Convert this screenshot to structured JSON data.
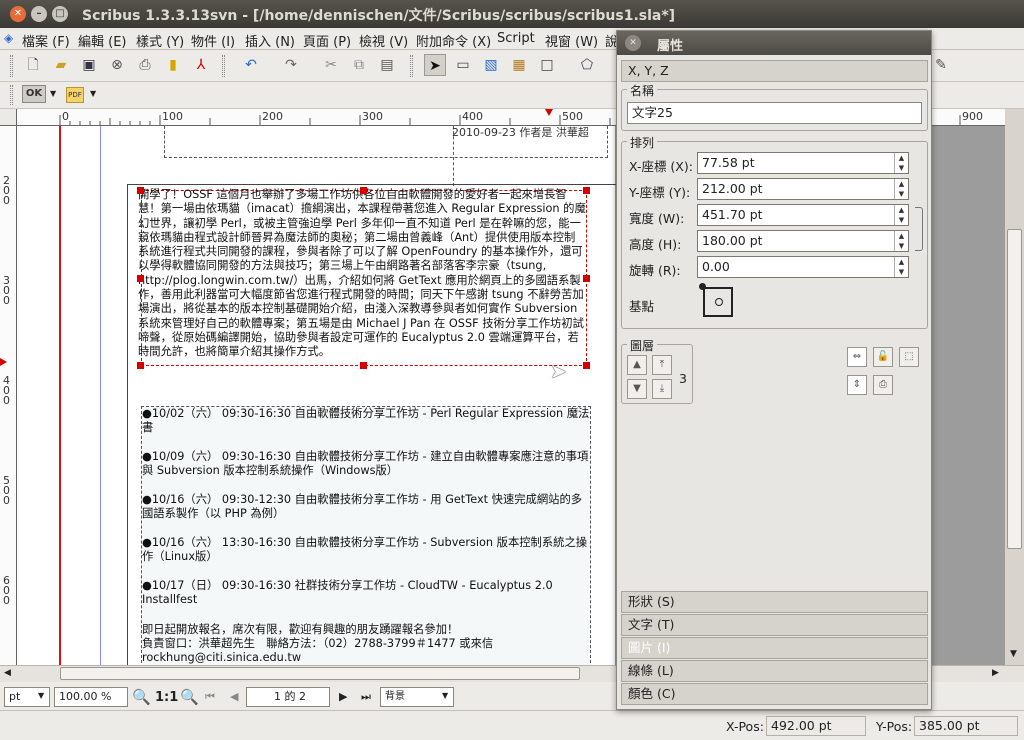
{
  "window": {
    "title": "Scribus 1.3.3.13svn - [/home/dennischen/文件/Scribus/scribus/scribus1.sla*]"
  },
  "menu": [
    "檔案 (F)",
    "編輯 (E)",
    "樣式 (Y)",
    "物件 (I)",
    "插入 (N)",
    "頁面 (P)",
    "檢視 (V)",
    "附加命令 (X)",
    "Script",
    "視窗 (W)",
    "說明 (H)"
  ],
  "toolbar2": {
    "ok_label": "OK",
    "pdf_label": "PDF"
  },
  "ruler": {
    "h": [
      "0",
      "100",
      "200",
      "300",
      "400",
      "500",
      "900"
    ],
    "v": [
      "200",
      "300",
      "400",
      "500",
      "600"
    ]
  },
  "document": {
    "header_fragment": "2010-09-23   作者是 洪華超",
    "paragraph": "開學了！OSSF 這個月也舉辦了多場工作坊供各位自由軟體開發的愛好者一起來增長智慧！第一場由依瑪貓（imacat）擔綱演出，本課程帶著您進入 Regular Expression 的魔幻世界，讓初學 Perl，或被主管強迫學 Perl 多年仰一直不知道 Perl 是在幹嘛的您，能一窺依瑪貓由程式設計師晉昇為魔法師的奧秘；第二場由曾義峰（Ant）提供使用版本控制系統進行程式共同開發的課程，參與者除了可以了解 OpenFoundry 的基本操作外，還可以學得軟體協同開發的方法與技巧；第三場上午由網路著名部落客李宗豪（tsung, http://plog.longwin.com.tw/）出馬，介紹如何將 GetText 應用於網頁上的多國語系製作，善用此利器當可大幅度節省您進行程式開發的時間；同天下午感謝 tsung 不辭勞苦加場演出，將從基本的版本控制基礎開始介紹，由淺入深教導參與者如何實作 Subversion 系統來管理好自己的軟體專案；第五場是由 Michael J Pan 在 OSSF 技術分享工作坊初試啼聲，從原始碼編譯開始，協助參與者設定可運作的 Eucalyptus 2.0 雲端運算平台，若時間允許，也將簡單介紹其操作方式。",
    "events": [
      "●10/02（六） 09:30-16:30 自由軟體技術分享工作坊 - Perl Regular Expression 魔法書",
      "●10/09（六） 09:30-16:30 自由軟體技術分享工作坊 - 建立自由軟體專案應注意的事項與 Subversion 版本控制系統操作（Windows版）",
      "●10/16（六） 09:30-12:30 自由軟體技術分享工作坊 - 用 GetText 快速完成網站的多國語系製作（以 PHP 為例）",
      "●10/16（六） 13:30-16:30 自由軟體技術分享工作坊 - Subversion 版本控制系統之操作（Linux版）",
      "●10/17（日） 09:30-16:30 社群技術分享工作坊 - CloudTW - Eucalyptus 2.0 Installfest"
    ],
    "footer1": "即日起開放報名，席次有限，歡迎有興趣的朋友踴躍報名參加！",
    "footer2": "負責窗口：洪華超先生　聯絡方法：（02）2788-3799＃1477 或來信",
    "footer3": "rockhung@citi.sinica.edu.tw"
  },
  "properties": {
    "title": "屬性",
    "xyz_tab": "X, Y, Z",
    "name_group": "名稱",
    "name_value": "文字25",
    "geometry_group": "排列",
    "x_label": "X-座標 (X):",
    "x_value": "77.58 pt",
    "y_label": "Y-座標 (Y):",
    "y_value": "212.00 pt",
    "w_label": "寬度 (W):",
    "w_value": "451.70 pt",
    "h_label": "高度 (H):",
    "h_value": "180.00 pt",
    "r_label": "旋轉 (R):",
    "r_value": "0.00",
    "basepoint_label": "基點",
    "layer_group": "圖層",
    "layer_value": "3",
    "sections": [
      "形狀 (S)",
      "文字 (T)",
      "圖片 (I)",
      "線條 (L)",
      "顏色 (C)"
    ]
  },
  "bottom": {
    "unit": "pt",
    "zoom": "100.00 %",
    "one_to_one": "1:1",
    "page_nav": "1 的 2",
    "layer_select": "背景",
    "xpos_label": "X-Pos:",
    "xpos_value": "492.00 pt",
    "ypos_label": "Y-Pos:",
    "ypos_value": "385.00 pt"
  },
  "colors": {
    "selection": "#d40000",
    "guide_red": "#e01010",
    "guide_blue": "#8a8aff"
  }
}
